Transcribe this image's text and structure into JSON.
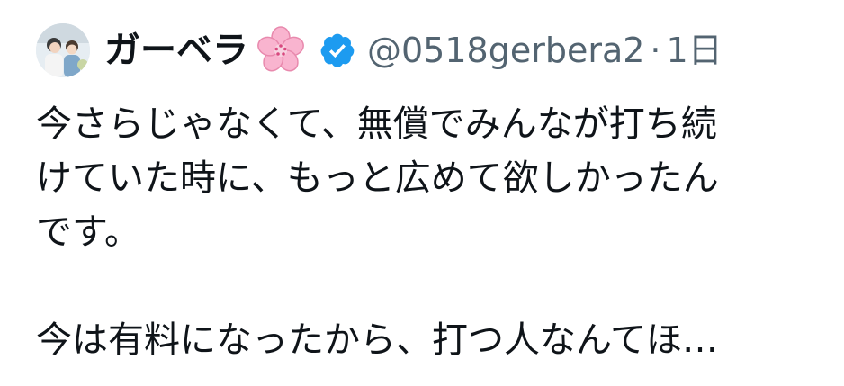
{
  "tweet": {
    "display_name": "ガーベラ",
    "name_emoji_icon": "cherry-blossom-icon",
    "verified_icon": "verified-badge-icon",
    "handle": "@0518gerbera2",
    "separator": "·",
    "time": "1日",
    "body_lines": [
      "今さらじゃなくて、無償でみんなが打ち続",
      "けていた時に、もっと広めて欲しかったん",
      "です。",
      "",
      "今は有料になったから、打つ人なんてほ…"
    ],
    "colors": {
      "text": "#0f1419",
      "secondary": "#536471",
      "verified": "#1d9bf0",
      "flower": "#f7a8c8"
    }
  }
}
